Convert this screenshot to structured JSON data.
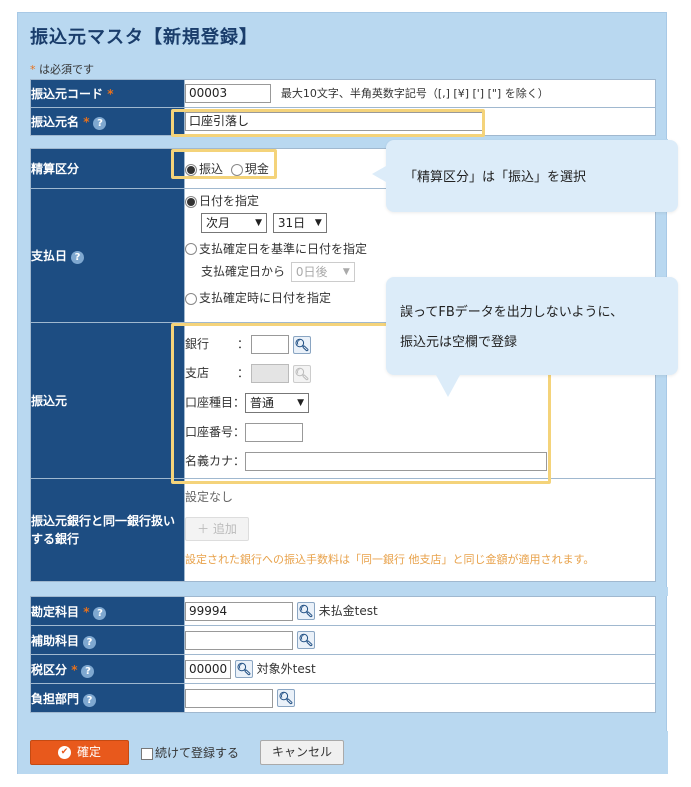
{
  "title": "振込元マスタ【新規登録】",
  "required_note": "は必須です",
  "required_mark": "*",
  "fields": {
    "code": {
      "label": "振込元コード",
      "value": "00003",
      "hint": "最大10文字、半角英数字記号（[,] [¥] ['] [\"] を除く）"
    },
    "name": {
      "label": "振込元名",
      "value": "口座引落し"
    },
    "settlement": {
      "label": "精算区分",
      "options": [
        "振込",
        "現金"
      ],
      "selected": "振込"
    },
    "payday": {
      "label": "支払日",
      "opt1": "日付を指定",
      "month": "次月",
      "day": "31日",
      "opt2": "支払確定日を基準に日付を指定",
      "from_label": "支払確定日から",
      "offset": "0日後",
      "opt3": "支払確定時に日付を指定"
    },
    "source": {
      "label": "振込元",
      "bank": "銀行",
      "branch": "支店",
      "colon": "：",
      "account_type": "口座種目：",
      "account_type_value": "普通",
      "account_no": "口座番号：",
      "holder": "名義カナ："
    },
    "same_bank": {
      "label": "振込元銀行と同一銀行扱いする銀行",
      "none": "設定なし",
      "add": "追加",
      "note": "設定された銀行への振込手数料は「同一銀行 他支店」と同じ金額が適用されます。"
    },
    "account": {
      "label": "勘定科目",
      "value": "99994",
      "name": "未払金test"
    },
    "sub_account": {
      "label": "補助科目"
    },
    "tax": {
      "label": "税区分",
      "value": "00000",
      "name": "対象外test"
    },
    "dept": {
      "label": "負担部門"
    }
  },
  "footer": {
    "confirm": "確定",
    "continue": "続けて登録する",
    "cancel": "キャンセル"
  },
  "callouts": {
    "c1": "「精算区分」は「振込」を選択",
    "c2_line1": "誤ってFBデータを出力しないように、",
    "c2_line2": "振込元は空欄で登録"
  },
  "colors": {
    "header": "#1d4d82",
    "panel": "#b9d8f0",
    "accent": "#e8591c",
    "highlight": "#f4d37a",
    "callout": "#dcecf9"
  }
}
